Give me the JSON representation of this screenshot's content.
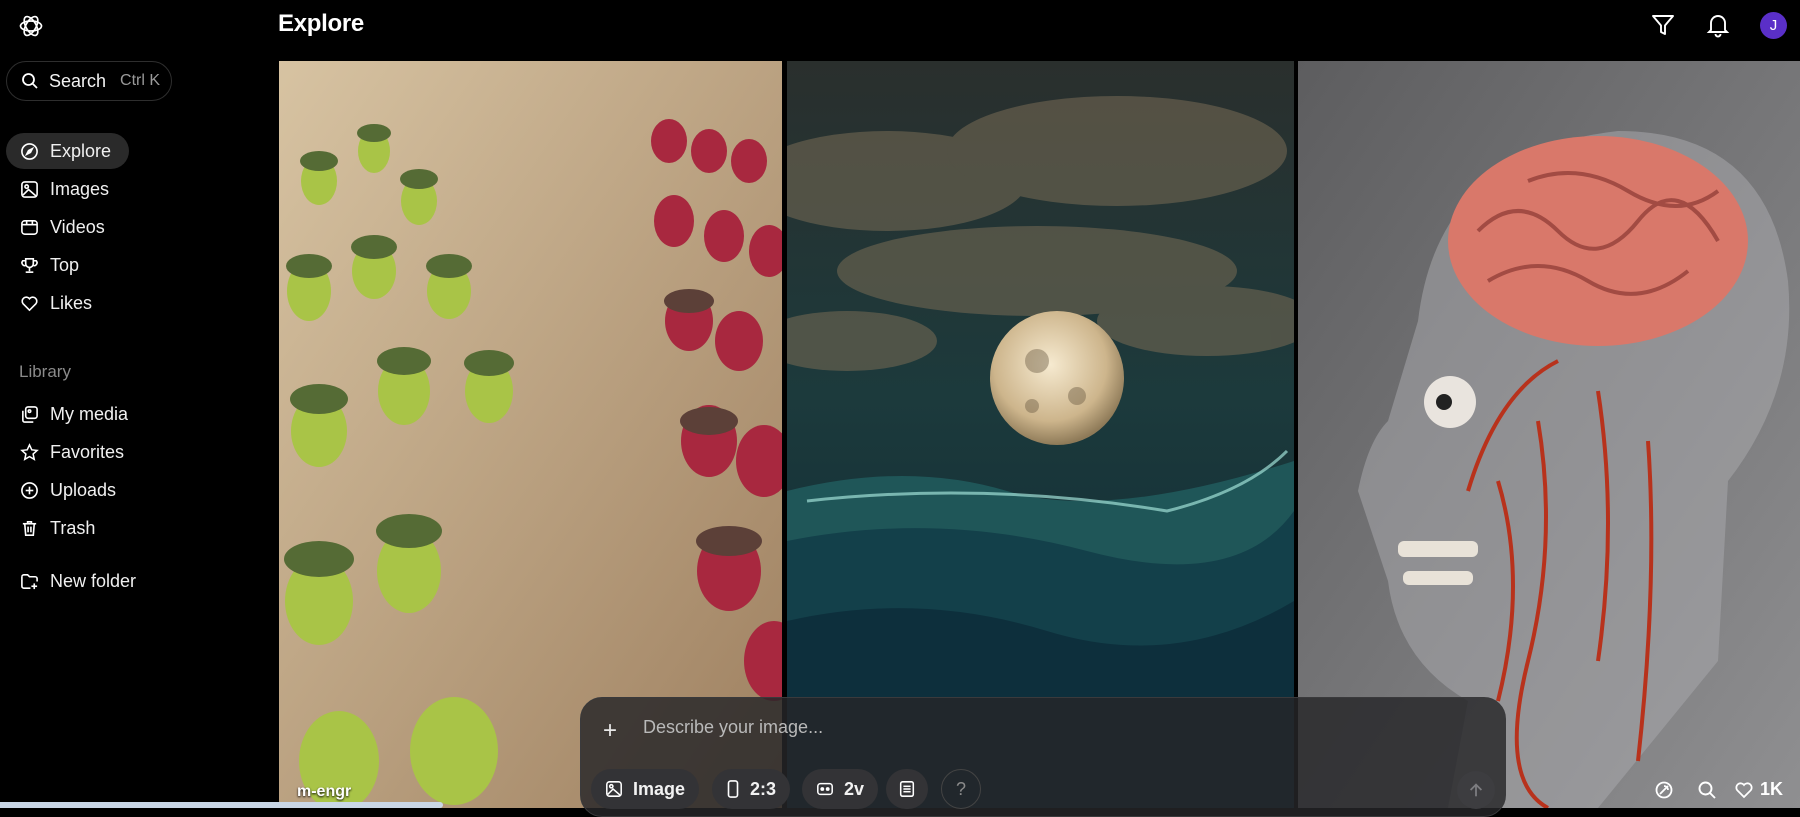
{
  "header": {
    "title": "Explore",
    "avatar_initial": "J"
  },
  "search": {
    "label": "Search",
    "shortcut": "Ctrl K"
  },
  "sidebar": {
    "nav": [
      {
        "label": "Explore",
        "icon": "compass-icon",
        "active": true
      },
      {
        "label": "Images",
        "icon": "image-icon"
      },
      {
        "label": "Videos",
        "icon": "video-icon"
      },
      {
        "label": "Top",
        "icon": "trophy-icon"
      },
      {
        "label": "Likes",
        "icon": "heart-icon"
      }
    ],
    "library_label": "Library",
    "library": [
      {
        "label": "My media",
        "icon": "media-icon"
      },
      {
        "label": "Favorites",
        "icon": "star-icon"
      },
      {
        "label": "Uploads",
        "icon": "upload-icon"
      },
      {
        "label": "Trash",
        "icon": "trash-icon"
      }
    ],
    "new_folder": "New folder"
  },
  "gallery": {
    "author": "m-engr",
    "likes": "1K"
  },
  "composer": {
    "placeholder": "Describe your image...",
    "mode": "Image",
    "aspect": "2:3",
    "variants": "2v",
    "help": "?"
  },
  "colors": {
    "accent": "#5a2fc8",
    "background": "#000000"
  }
}
